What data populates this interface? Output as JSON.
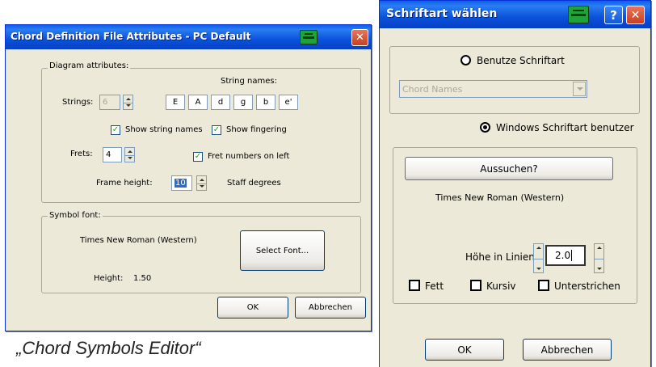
{
  "left_dialog": {
    "title": "Chord Definition File Attributes - PC Default",
    "diagram_group": {
      "legend": "Diagram attributes:",
      "strings_label": "Strings:",
      "strings_value": "6",
      "string_names_label": "String names:",
      "string_names": [
        "E",
        "A",
        "d",
        "g",
        "b",
        "e'"
      ],
      "show_string_names": "Show string names",
      "show_fingering": "Show fingering",
      "frets_label": "Frets:",
      "frets_value": "4",
      "fret_numbers_left": "Fret numbers on left",
      "frame_height_label": "Frame height:",
      "frame_height_value": "10",
      "staff_degrees": "Staff degrees"
    },
    "symbol_group": {
      "legend": "Symbol font:",
      "font_name": "Times New Roman (Western)",
      "select_font": "Select Font...",
      "height_label": "Height:",
      "height_value": "1.50"
    },
    "ok": "OK",
    "cancel": "Abbrechen"
  },
  "right_dialog": {
    "title": "Schriftart wählen",
    "use_font_radio": "Benutze Schriftart",
    "font_dropdown_value": "Chord Names",
    "windows_font_radio": "Windows Schriftart benutzer",
    "choose_button": "Aussuchen?",
    "font_name": "Times New Roman (Western)",
    "height_label": "Höhe in Linien:",
    "height_value": "2.0",
    "bold": "Fett",
    "italic": "Kursiv",
    "underline": "Unterstrichen",
    "ok": "OK",
    "cancel": "Abbrechen"
  },
  "caption": "„Chord Symbols Editor“"
}
